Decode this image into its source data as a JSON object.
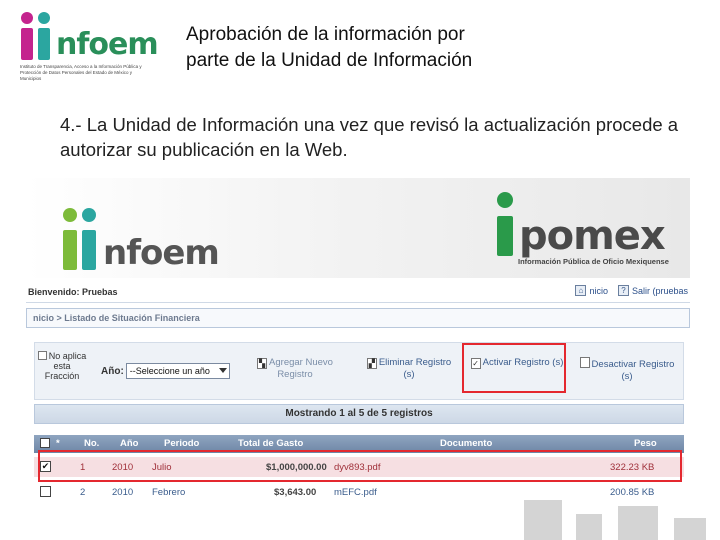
{
  "slide": {
    "logo_text": "nfoem",
    "logo_subtitle": "Instituto de Transparencia, Acceso a la Información Pública y Protección de Datos Personales del Estado de México y Municipios",
    "title_line1": "Aprobación de la información por",
    "title_line2": "parte de la Unidad de Información",
    "body": "4.- La Unidad de Información una vez que revisó la actualización procede a autorizar su publicación en la Web."
  },
  "screenshot": {
    "banner": {
      "left_logo": "nfoem",
      "right_logo": "pomex",
      "right_subtitle": "Información Pública de Oficio Mexiquense"
    },
    "welcome": "Bienvenido: Pruebas",
    "top_links": {
      "home": "nicio",
      "logout": "Salir (pruebas"
    },
    "breadcrumb": "nicio > Listado de Situación Financiera",
    "toolbar": {
      "no_apply": "No aplica esta Fracción",
      "year_label": "Año:",
      "year_select": "--Seleccione un año",
      "add": "Agregar Nuevo Registro",
      "delete": "Eliminar Registro (s)",
      "activate": "Activar Registro (s)",
      "deactivate": "Desactivar Registro (s)"
    },
    "records_info": "Mostrando 1 al 5 de 5 registros",
    "table": {
      "headers": {
        "sort": "*",
        "no": "No.",
        "year": "Año",
        "period": "Periodo",
        "total": "Total de Gasto",
        "document": "Documento",
        "size": "Peso"
      },
      "rows": [
        {
          "checked": "✔",
          "no": "1",
          "year": "2010",
          "period": "Julio",
          "total": "$1,000,000.00",
          "document": "dyv893.pdf",
          "size": "322.23 KB"
        },
        {
          "checked": "",
          "no": "2",
          "year": "2010",
          "period": "Febrero",
          "total": "$3,643.00",
          "document": "mEFC.pdf",
          "size": "200.85 KB"
        }
      ]
    }
  },
  "colors": {
    "highlight": "#e4282f",
    "brand_green": "#2a8f5a",
    "brand_magenta": "#c4248e",
    "brand_teal": "#2ba6a0"
  }
}
